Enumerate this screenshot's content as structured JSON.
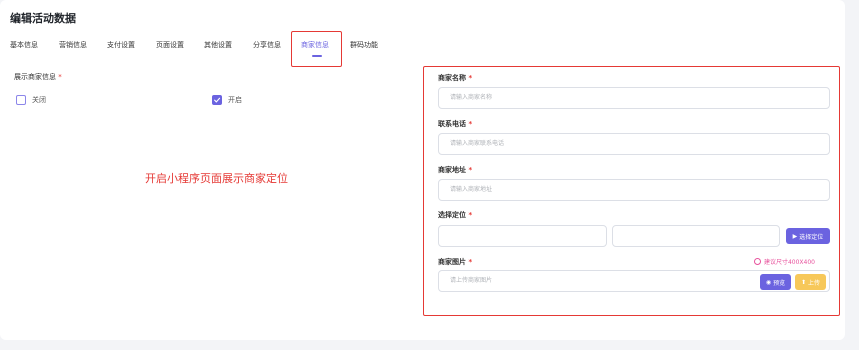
{
  "page": {
    "title": "编辑活动数据"
  },
  "tabs": [
    {
      "label": "基本信息",
      "active": false
    },
    {
      "label": "营销信息",
      "active": false
    },
    {
      "label": "支付设置",
      "active": false
    },
    {
      "label": "页面设置",
      "active": false
    },
    {
      "label": "其他设置",
      "active": false
    },
    {
      "label": "分享信息",
      "active": false
    },
    {
      "label": "商家信息",
      "active": true
    },
    {
      "label": "群码功能",
      "active": false
    }
  ],
  "show_merchant": {
    "label": "展示商家信息",
    "required_mark": "*",
    "options": [
      {
        "label": "关闭",
        "checked": false
      },
      {
        "label": "开启",
        "checked": true
      }
    ]
  },
  "annotation": "开启小程序页面展示商家定位",
  "form": {
    "merchant_name": {
      "label": "商家名称",
      "required_mark": "*",
      "placeholder": "请输入商家名称"
    },
    "phone": {
      "label": "联系电话",
      "required_mark": "*",
      "placeholder": "请输入商家联系电话"
    },
    "address": {
      "label": "商家地址",
      "required_mark": "*",
      "placeholder": "请输入商家地址"
    },
    "location": {
      "label": "选择定位",
      "required_mark": "*",
      "button": "选择定位"
    },
    "image": {
      "label": "商家图片",
      "required_mark": "*",
      "hint": "建议尺寸400X400",
      "placeholder": "请上传商家图片",
      "preview_button": "预览",
      "upload_button": "上传"
    }
  },
  "colors": {
    "accent": "#6b63e0",
    "highlight": "#e53935",
    "upload": "#f7c85a",
    "hint": "#e8539d"
  }
}
